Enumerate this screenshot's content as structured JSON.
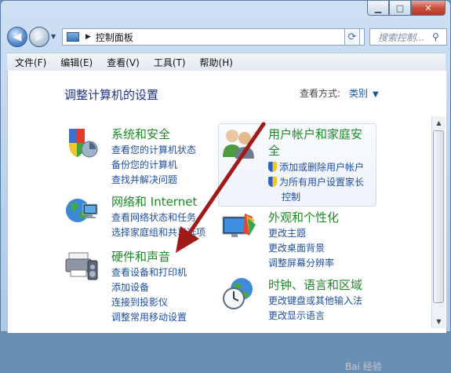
{
  "window": {
    "caption_buttons": [
      "minimize-icon",
      "maximize-icon",
      "close-icon"
    ]
  },
  "navigation": {
    "address_path": "控制面板",
    "search_placeholder": "搜索控制..."
  },
  "menu": [
    "文件(F)",
    "编辑(E)",
    "查看(V)",
    "工具(T)",
    "帮助(H)"
  ],
  "header": {
    "title": "调整计算机的设置",
    "view_by_label": "查看方式:",
    "view_by_value": "类别"
  },
  "categories": [
    {
      "title": "系统和安全",
      "icon": "system-security-icon",
      "links": [
        "查看您的计算机状态",
        "备份您的计算机",
        "查找并解决问题"
      ]
    },
    {
      "title": "网络和 Internet",
      "icon": "network-icon",
      "links": [
        "查看网络状态和任务",
        "选择家庭组和共享选项"
      ]
    },
    {
      "title": "硬件和声音",
      "icon": "hardware-sound-icon",
      "links": [
        "查看设备和打印机",
        "添加设备",
        "连接到投影仪",
        "调整常用移动设置"
      ]
    },
    {
      "title_line1": "用户帐户和家庭安",
      "title_line2": "全",
      "icon": "user-accounts-icon",
      "links": [
        "添加或删除用户帐户",
        "为所有用户设置家长",
        "控制"
      ]
    },
    {
      "title": "外观和个性化",
      "icon": "appearance-icon",
      "links": [
        "更改主题",
        "更改桌面背景",
        "调整屏幕分辨率"
      ]
    },
    {
      "title": "时钟、语言和区域",
      "icon": "clock-region-icon",
      "links": [
        "更改键盘或其他输入法",
        "更改显示语言"
      ]
    }
  ],
  "annotation": {
    "arrow_color": "#a01a1a"
  },
  "watermark": "Bai 经验"
}
